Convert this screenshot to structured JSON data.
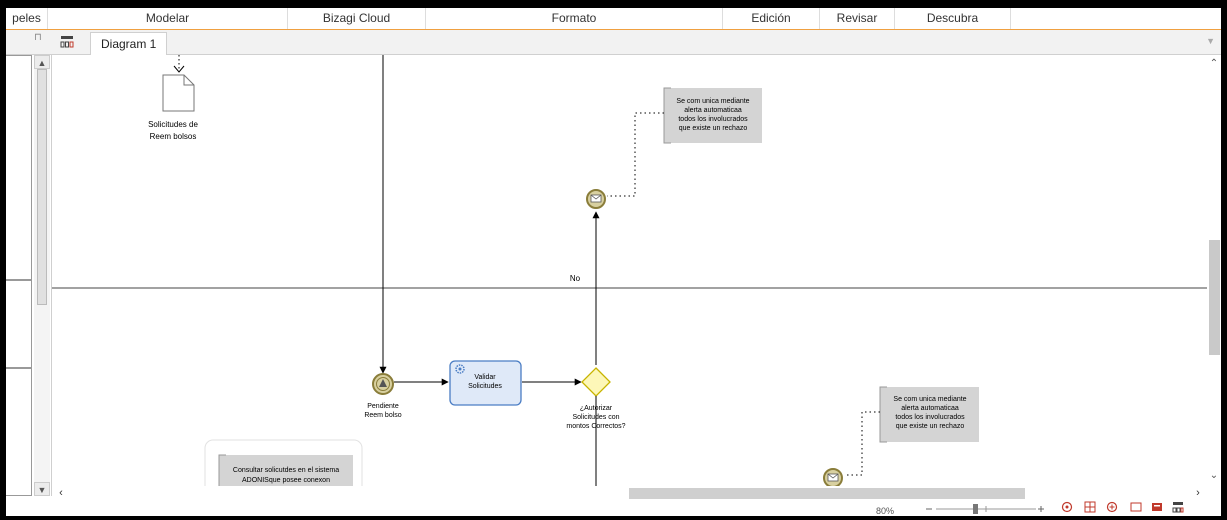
{
  "ribbon": {
    "tabs": [
      {
        "label": "peles"
      },
      {
        "label": "Modelar"
      },
      {
        "label": "Bizagi Cloud"
      },
      {
        "label": "Formato"
      },
      {
        "label": "Edición"
      },
      {
        "label": "Revisar"
      },
      {
        "label": "Descubra"
      },
      {
        "label": ""
      }
    ]
  },
  "document_tab": {
    "label": "Diagram 1"
  },
  "diagram": {
    "artifact": {
      "label_1": "Solicitudes de",
      "label_2": "Reem bolsos"
    },
    "annotation_top": {
      "line1": "Se com unica mediante",
      "line2": "alerta automaticaa",
      "line3": "todos los involucrados",
      "line4": "que existe un rechazo"
    },
    "annotation_bottom": {
      "line1": "Se com unica mediante",
      "line2": "alerta automaticaa",
      "line3": "todos los involucrados",
      "line4": "que existe un rechazo"
    },
    "flow_label_no": "No",
    "event_pending": {
      "line1": "Pendiente",
      "line2": "Reem bolso"
    },
    "task_validate": {
      "line1": "Validar",
      "line2": "Solicitudes"
    },
    "gateway": {
      "line1": "¿Autorizar",
      "line2": "Solicitudes con",
      "line3": "montos Correctos?"
    },
    "note_bottom": {
      "line1": "Consultar solicutdes en el sistema",
      "line2": "ADONISque posee conexon"
    }
  },
  "status_bar": {
    "zoom": "80%",
    "zoom_level": 0.8
  },
  "colors": {
    "accent": "#f0a040",
    "task_fill": "#dfe9f8",
    "task_border": "#4a7dc4",
    "gateway_fill": "#fdf7b8",
    "gateway_border": "#c8b400",
    "event_fill": "#d8d0a0",
    "annotation_fill": "#d4d4d4"
  },
  "icons": [
    "pin-icon",
    "diagram-icon",
    "chevron-up-icon",
    "chevron-down-icon",
    "chevron-left-icon",
    "chevron-right-icon",
    "gear-icon",
    "envelope-icon",
    "fit-icon",
    "grid-icon",
    "zoom-icon",
    "window-icon"
  ]
}
